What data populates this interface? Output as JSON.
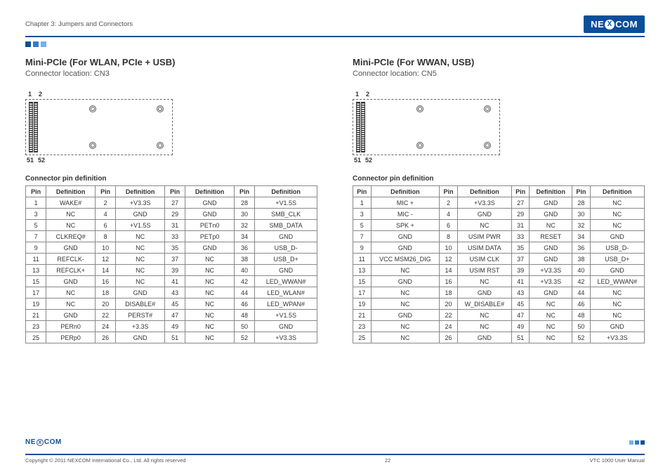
{
  "header": {
    "chapter": "Chapter 3: Jumpers and Connectors",
    "logo_pre": "NE",
    "logo_x": "X",
    "logo_post": "COM"
  },
  "squares": [
    "#0a4f9a",
    "#2f7bd4",
    "#6fb2ef"
  ],
  "left": {
    "title": "Mini-PCIe (For WLAN, PCIe + USB)",
    "sub": "Connector location: CN3",
    "diag_top": [
      "1",
      "2"
    ],
    "diag_bot": [
      "51",
      "52"
    ],
    "table_caption": "Connector pin definition",
    "headers": [
      "Pin",
      "Definition",
      "Pin",
      "Definition",
      "Pin",
      "Definition",
      "Pin",
      "Definition"
    ],
    "rows": [
      [
        "1",
        "WAKE#",
        "2",
        "+V3.3S",
        "27",
        "GND",
        "28",
        "+V1.5S"
      ],
      [
        "3",
        "NC",
        "4",
        "GND",
        "29",
        "GND",
        "30",
        "SMB_CLK"
      ],
      [
        "5",
        "NC",
        "6",
        "+V1.5S",
        "31",
        "PETn0",
        "32",
        "SMB_DATA"
      ],
      [
        "7",
        "CLKREQ#",
        "8",
        "NC",
        "33",
        "PETp0",
        "34",
        "GND"
      ],
      [
        "9",
        "GND",
        "10",
        "NC",
        "35",
        "GND",
        "36",
        "USB_D-"
      ],
      [
        "11",
        "REFCLK-",
        "12",
        "NC",
        "37",
        "NC",
        "38",
        "USB_D+"
      ],
      [
        "13",
        "REFCLK+",
        "14",
        "NC",
        "39",
        "NC",
        "40",
        "GND"
      ],
      [
        "15",
        "GND",
        "16",
        "NC",
        "41",
        "NC",
        "42",
        "LED_WWAN#"
      ],
      [
        "17",
        "NC",
        "18",
        "GND",
        "43",
        "NC",
        "44",
        "LED_WLAN#"
      ],
      [
        "19",
        "NC",
        "20",
        "DISABLE#",
        "45",
        "NC",
        "46",
        "LED_WPAN#"
      ],
      [
        "21",
        "GND",
        "22",
        "PERST#",
        "47",
        "NC",
        "48",
        "+V1.5S"
      ],
      [
        "23",
        "PERn0",
        "24",
        "+3.3S",
        "49",
        "NC",
        "50",
        "GND"
      ],
      [
        "25",
        "PERp0",
        "26",
        "GND",
        "51",
        "NC",
        "52",
        "+V3.3S"
      ]
    ]
  },
  "right": {
    "title": "Mini-PCIe (For WWAN, USB)",
    "sub": "Connector location: CN5",
    "diag_top": [
      "1",
      "2"
    ],
    "diag_bot": [
      "51",
      "52"
    ],
    "table_caption": "Connector pin definition",
    "headers": [
      "Pin",
      "Definition",
      "Pin",
      "Definition",
      "Pin",
      "Definition",
      "Pin",
      "Definition"
    ],
    "rows": [
      [
        "1",
        "MIC +",
        "2",
        "+V3.3S",
        "27",
        "GND",
        "28",
        "NC"
      ],
      [
        "3",
        "MIC -",
        "4",
        "GND",
        "29",
        "GND",
        "30",
        "NC"
      ],
      [
        "5",
        "SPK +",
        "6",
        "NC",
        "31",
        "NC",
        "32",
        "NC"
      ],
      [
        "7",
        "GND",
        "8",
        "USIM PWR",
        "33",
        "RESET",
        "34",
        "GND"
      ],
      [
        "9",
        "GND",
        "10",
        "USIM DATA",
        "35",
        "GND",
        "36",
        "USB_D-"
      ],
      [
        "11",
        "VCC MSM26_DIG",
        "12",
        "USIM CLK",
        "37",
        "GND",
        "38",
        "USB_D+"
      ],
      [
        "13",
        "NC",
        "14",
        "USIM RST",
        "39",
        "+V3.3S",
        "40",
        "GND"
      ],
      [
        "15",
        "GND",
        "16",
        "NC",
        "41",
        "+V3.3S",
        "42",
        "LED_WWAN#"
      ],
      [
        "17",
        "NC",
        "18",
        "GND",
        "43",
        "GND",
        "44",
        "NC"
      ],
      [
        "19",
        "NC",
        "20",
        "W_DISABLE#",
        "45",
        "NC",
        "46",
        "NC"
      ],
      [
        "21",
        "GND",
        "22",
        "NC",
        "47",
        "NC",
        "48",
        "NC"
      ],
      [
        "23",
        "NC",
        "24",
        "NC",
        "49",
        "NC",
        "50",
        "GND"
      ],
      [
        "25",
        "NC",
        "26",
        "GND",
        "51",
        "NC",
        "52",
        "+V3.3S"
      ]
    ]
  },
  "footer": {
    "copyright": "Copyright © 2011 NEXCOM International Co., Ltd. All rights reserved",
    "page": "22",
    "manual": "VTC 1000 User Manual"
  }
}
